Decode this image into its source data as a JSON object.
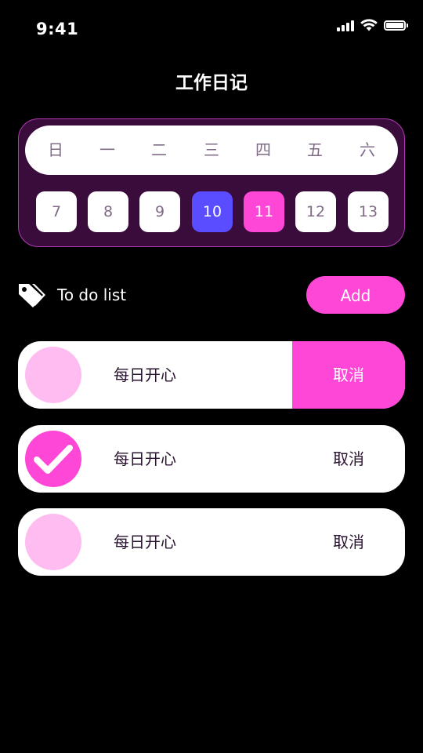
{
  "status_bar": {
    "time": "9:41",
    "icons": [
      "cellular-signal-icon",
      "wifi-icon",
      "battery-icon"
    ]
  },
  "header": {
    "title": "工作日记"
  },
  "calendar": {
    "weekdays": [
      "日",
      "一",
      "二",
      "三",
      "四",
      "五",
      "六"
    ],
    "days": [
      "7",
      "8",
      "9",
      "10",
      "11",
      "12",
      "13"
    ],
    "highlight_blue_day": "10",
    "highlight_pink_day": "11"
  },
  "todo": {
    "icon": "tag-icon",
    "label": "To do list",
    "add_label": "Add",
    "items": [
      {
        "text": "每日开心",
        "action": "取消",
        "checked": false,
        "action_highlighted": true
      },
      {
        "text": "每日开心",
        "action": "取消",
        "checked": true,
        "action_highlighted": false
      },
      {
        "text": "每日开心",
        "action": "取消",
        "checked": false,
        "action_highlighted": false
      }
    ]
  },
  "colors": {
    "background": "#000000",
    "accent_pink": "#ff47d7",
    "accent_blue": "#5a4dff",
    "light_pink": "#ffbcf0",
    "calendar_bg": "#3a0c3b",
    "calendar_border": "#b13ab4",
    "muted_text": "#7f6b86"
  }
}
